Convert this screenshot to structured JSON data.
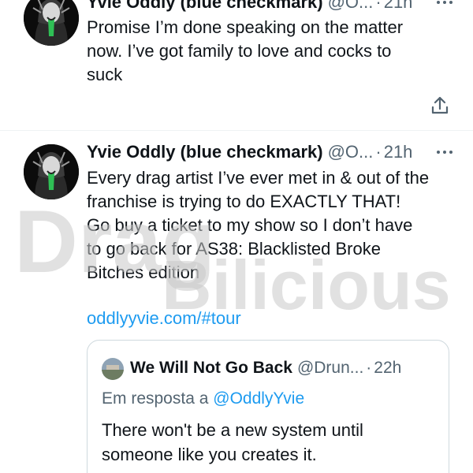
{
  "tweet1": {
    "display_name": "Yvie Oddly (blue checkmark)",
    "handle": "@O...",
    "separator": "·",
    "time": "21h",
    "text_lines": [
      "Promise I’m done speaking on the matter",
      "now. I’ve got family to love and cocks to",
      "suck"
    ],
    "more_icon": "more-horizontal-icon",
    "share_icon": "share-upload-icon"
  },
  "tweet2": {
    "display_name": "Yvie Oddly (blue checkmark)",
    "handle": "@O...",
    "separator": "·",
    "time": "21h",
    "text_lines": [
      "Every drag artist I’ve ever met in & out of the",
      "franchise is trying to do EXACTLY THAT!",
      "Go buy a ticket to my show so I don’t have",
      "to go back for AS38: Blacklisted Broke",
      "Bitches edition"
    ],
    "link": "oddlyyvie.com/#tour",
    "more_icon": "more-horizontal-icon"
  },
  "quoted": {
    "display_name": "We Will Not Go Back",
    "handle": "@Drun...",
    "separator": "·",
    "time": "22h",
    "reply_prefix": "Em resposta a",
    "reply_mention": "@OddlyYvie",
    "text_lines": [
      "There won't be a new system until",
      "someone like you creates it."
    ]
  },
  "watermark": {
    "line1": "Drag",
    "line2": "Bilicious"
  },
  "colors": {
    "text": "#0f1419",
    "secondary": "#536471",
    "link": "#1d9bf0",
    "border": "#cfd9de",
    "watermark": "#c8c8c8"
  }
}
